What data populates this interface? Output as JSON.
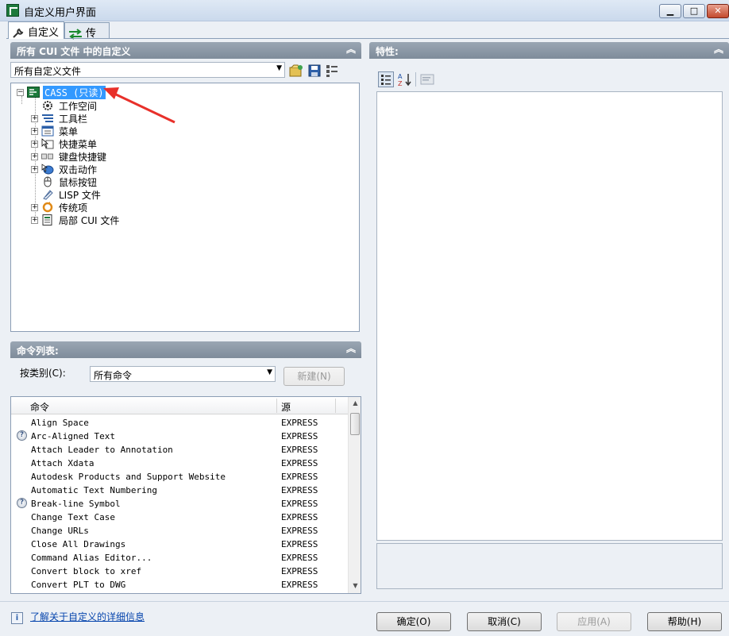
{
  "window": {
    "title": "自定义用户界面",
    "min_glyph": "▁",
    "max_glyph": "□",
    "close_glyph": "✕"
  },
  "tabs": [
    {
      "label": "自定义",
      "icon": "wrench-icon"
    },
    {
      "label": "传输",
      "icon": "transfer-arrows-icon"
    }
  ],
  "left_panel": {
    "header": "所有 CUI 文件 中的自定义",
    "file_combo": "所有自定义文件",
    "tree": [
      {
        "label": "CASS (只读)",
        "icon": "cass-icon",
        "selected": true,
        "expander": "−"
      },
      {
        "label": "工作空间",
        "icon": "workspace-gear-icon"
      },
      {
        "label": "工具栏",
        "icon": "toolbar-icon",
        "expander": "+"
      },
      {
        "label": "菜单",
        "icon": "menu-icon",
        "expander": "+"
      },
      {
        "label": "快捷菜单",
        "icon": "shortcut-menu-icon",
        "expander": "+"
      },
      {
        "label": "键盘快捷键",
        "icon": "keyboard-icon",
        "expander": "+"
      },
      {
        "label": "双击动作",
        "icon": "double-click-icon",
        "expander": "+"
      },
      {
        "label": "鼠标按钮",
        "icon": "mouse-icon"
      },
      {
        "label": "LISP 文件",
        "icon": "lisp-file-icon"
      },
      {
        "label": "传统项",
        "icon": "legacy-icon",
        "expander": "+"
      },
      {
        "label": "局部 CUI 文件",
        "icon": "partial-cui-icon",
        "expander": "+"
      }
    ]
  },
  "commands_panel": {
    "header": "命令列表:",
    "category_label": "按类别(C):",
    "category_value": "所有命令",
    "new_button": "新建(N)",
    "columns": [
      "命令",
      "源"
    ],
    "rows": [
      {
        "name": "Align Space",
        "source": "EXPRESS",
        "help": false
      },
      {
        "name": "Arc-Aligned Text",
        "source": "EXPRESS",
        "help": true
      },
      {
        "name": "Attach Leader to Annotation",
        "source": "EXPRESS",
        "help": false
      },
      {
        "name": "Attach Xdata",
        "source": "EXPRESS",
        "help": false
      },
      {
        "name": "Autodesk Products and Support Website",
        "source": "EXPRESS",
        "help": false
      },
      {
        "name": "Automatic Text Numbering",
        "source": "EXPRESS",
        "help": false
      },
      {
        "name": "Break-line Symbol",
        "source": "EXPRESS",
        "help": true
      },
      {
        "name": "Change Text Case",
        "source": "EXPRESS",
        "help": false
      },
      {
        "name": "Change URLs",
        "source": "EXPRESS",
        "help": false
      },
      {
        "name": "Close All Drawings",
        "source": "EXPRESS",
        "help": false
      },
      {
        "name": "Command Alias Editor...",
        "source": "EXPRESS",
        "help": false
      },
      {
        "name": "Convert block to xref",
        "source": "EXPRESS",
        "help": false
      },
      {
        "name": "Convert PLT to DWG",
        "source": "EXPRESS",
        "help": false
      }
    ],
    "help_glyph": "?"
  },
  "properties_panel": {
    "header": "特性:"
  },
  "footer": {
    "info_glyph": "i",
    "info_link": "了解关于自定义的详细信息",
    "ok": "确定(O)",
    "cancel": "取消(C)",
    "apply": "应用(A)",
    "help": "帮助(H)"
  },
  "colors": {
    "selection": "#3399ff",
    "annotation_arrow": "#e8302a",
    "header_bg": "#8a96a4"
  }
}
